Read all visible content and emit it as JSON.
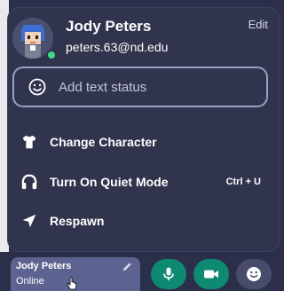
{
  "profile": {
    "name": "Jody Peters",
    "email": "peters.63@nd.edu",
    "edit_label": "Edit"
  },
  "status_input": {
    "placeholder": "Add text status"
  },
  "menu": [
    {
      "label": "Change Character",
      "icon": "shirt-icon",
      "shortcut": ""
    },
    {
      "label": "Turn On Quiet Mode",
      "icon": "headphones-icon",
      "shortcut": "Ctrl + U"
    },
    {
      "label": "Respawn",
      "icon": "navigation-arrow-icon",
      "shortcut": ""
    }
  ],
  "bottom_bar": {
    "name": "Jody Peters",
    "status": "Online"
  },
  "colors": {
    "popup_bg": "#30344d",
    "presence": "#3ddc84",
    "media_button": "#0e8a73",
    "chip_bg": "#5d6390"
  }
}
